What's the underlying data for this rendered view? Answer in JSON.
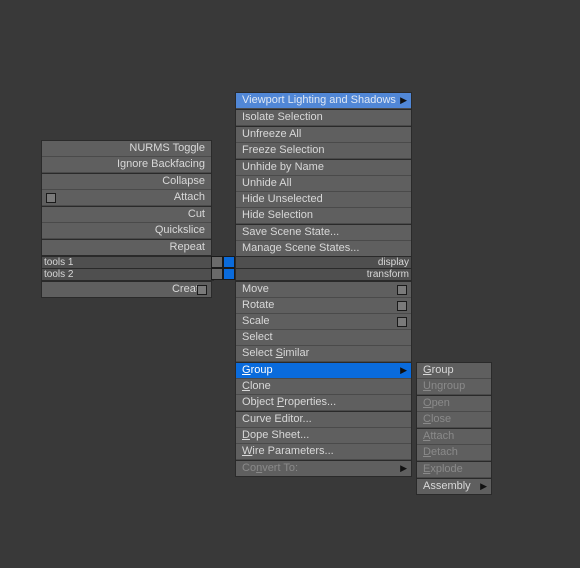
{
  "left_top": {
    "items": [
      {
        "label": "NURMS Toggle"
      },
      {
        "label": "Ignore Backfacing"
      },
      {
        "label": "Collapse",
        "heavy": true
      },
      {
        "label": "Attach",
        "box": "left"
      },
      {
        "label": "Cut",
        "heavy": true
      },
      {
        "label": "Quickslice"
      },
      {
        "label": "Repeat",
        "heavy": true
      }
    ]
  },
  "left_headers": {
    "h1": "tools 1",
    "h2": "tools 2"
  },
  "left_bottom": {
    "items": [
      {
        "label": "Create",
        "box": "right"
      }
    ]
  },
  "right_headers": {
    "h1": "display",
    "h2": "transform"
  },
  "right_top": {
    "items": [
      {
        "label": "Viewport Lighting and Shadows",
        "arrow": true,
        "sel": "dim"
      },
      {
        "label": "Isolate Selection",
        "heavy": true
      },
      {
        "label": "Unfreeze All",
        "heavy": true
      },
      {
        "label": "Freeze Selection"
      },
      {
        "label": "Unhide by Name",
        "heavy": true
      },
      {
        "label": "Unhide All"
      },
      {
        "label": "Hide Unselected"
      },
      {
        "label": "Hide Selection"
      },
      {
        "label": "Save Scene State...",
        "heavy": true
      },
      {
        "label": "Manage Scene States..."
      }
    ]
  },
  "right_bottom": {
    "items": [
      {
        "label": "Move",
        "box": "right"
      },
      {
        "label": "Rotate",
        "box": "right"
      },
      {
        "label": "Scale",
        "box": "right"
      },
      {
        "label": "Select"
      },
      {
        "label": "Select Similar",
        "u": 8
      },
      {
        "label": "Group",
        "u": 1,
        "arrow": true,
        "sel": true,
        "heavy": true
      },
      {
        "label": "Clone",
        "u": 1
      },
      {
        "label": "Object Properties...",
        "u": 8
      },
      {
        "label": "Curve Editor...",
        "heavy": true
      },
      {
        "label": "Dope Sheet...",
        "u": 1
      },
      {
        "label": "Wire Parameters...",
        "u": 1
      },
      {
        "label": "Convert To:",
        "u": 3,
        "arrow": true,
        "disabled": true,
        "heavy": true
      }
    ]
  },
  "submenu": {
    "items": [
      {
        "label": "Group",
        "u": 1
      },
      {
        "label": "Ungroup",
        "u": 1,
        "disabled": true
      },
      {
        "label": "Open",
        "u": 1,
        "disabled": true,
        "heavy": true
      },
      {
        "label": "Close",
        "u": 1,
        "disabled": true
      },
      {
        "label": "Attach",
        "u": 1,
        "disabled": true,
        "heavy": true
      },
      {
        "label": "Detach",
        "u": 1,
        "disabled": true
      },
      {
        "label": "Explode",
        "u": 1,
        "disabled": true,
        "heavy": true
      },
      {
        "label": "Assembly",
        "arrow": true,
        "heavy": true
      }
    ]
  }
}
